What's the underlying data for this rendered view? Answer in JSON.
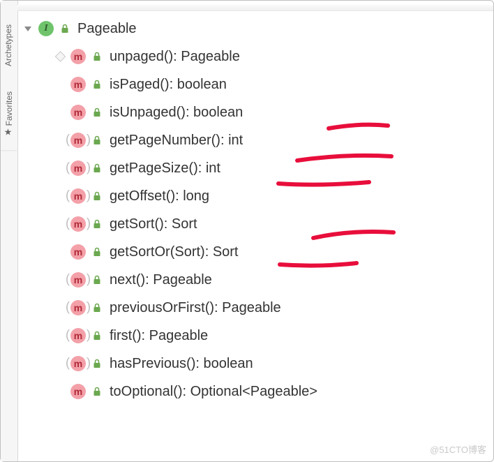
{
  "side_tabs": {
    "top_label": "Archetypes",
    "bottom_label": "Favorites"
  },
  "root": {
    "icon_letter": "I",
    "name": "Pageable"
  },
  "methods": [
    {
      "letter": "m",
      "parens": false,
      "sig": "unpaged(): Pageable"
    },
    {
      "letter": "m",
      "parens": false,
      "sig": "isPaged(): boolean"
    },
    {
      "letter": "m",
      "parens": false,
      "sig": "isUnpaged(): boolean"
    },
    {
      "letter": "m",
      "parens": true,
      "sig": "getPageNumber(): int"
    },
    {
      "letter": "m",
      "parens": true,
      "sig": "getPageSize(): int"
    },
    {
      "letter": "m",
      "parens": true,
      "sig": "getOffset(): long"
    },
    {
      "letter": "m",
      "parens": true,
      "sig": "getSort(): Sort"
    },
    {
      "letter": "m",
      "parens": false,
      "sig": "getSortOr(Sort): Sort"
    },
    {
      "letter": "m",
      "parens": true,
      "sig": "next(): Pageable"
    },
    {
      "letter": "m",
      "parens": true,
      "sig": "previousOrFirst(): Pageable"
    },
    {
      "letter": "m",
      "parens": true,
      "sig": "first(): Pageable"
    },
    {
      "letter": "m",
      "parens": true,
      "sig": "hasPrevious(): boolean"
    },
    {
      "letter": "m",
      "parens": false,
      "sig": "toOptional(): Optional<Pageable>"
    }
  ],
  "watermark": "@51CTO博客",
  "annotation_color": "#e80e3b"
}
